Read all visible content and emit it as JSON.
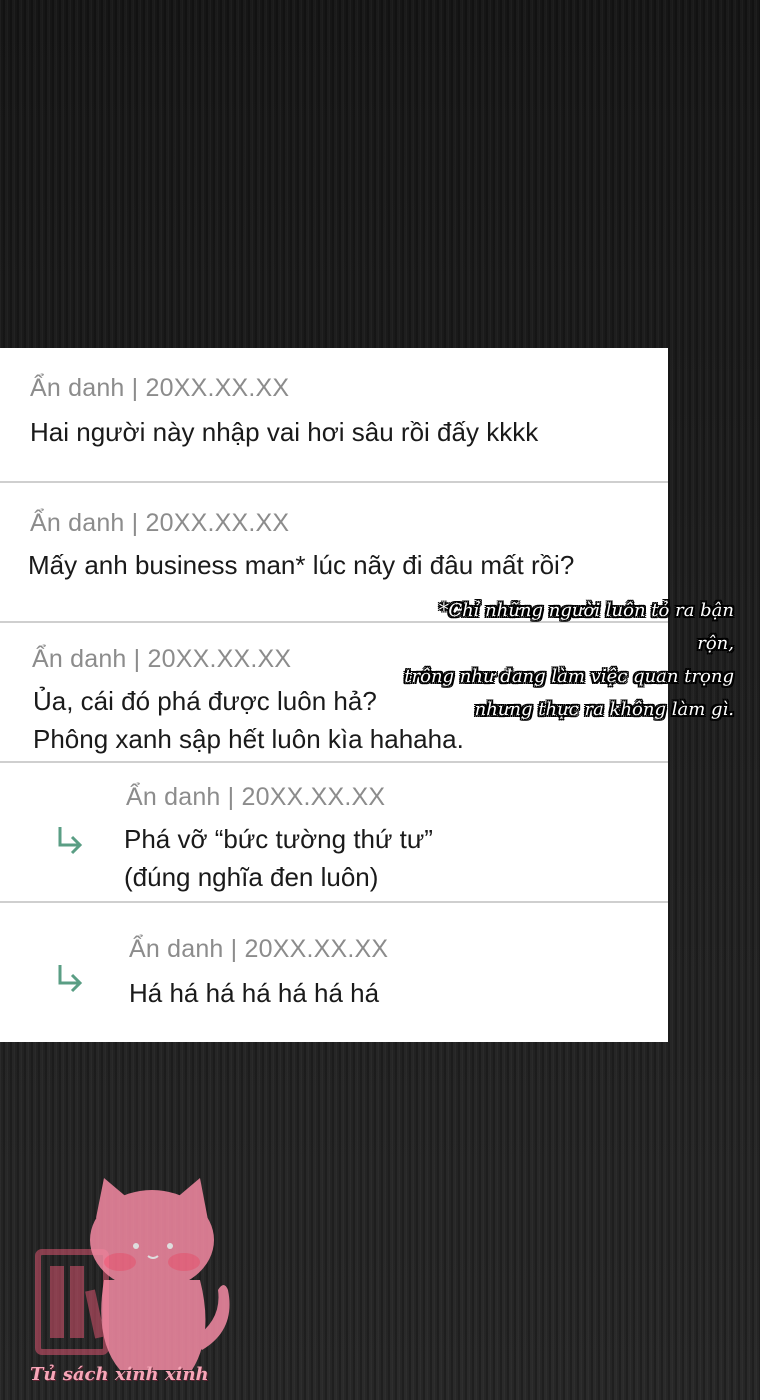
{
  "comments": [
    {
      "meta": "Ẩn danh | 20XX.XX.XX",
      "lines": [
        "Hai người này nhập vai hơi sâu rồi đấy kkkk"
      ],
      "is_reply": false
    },
    {
      "meta": "Ẩn danh | 20XX.XX.XX",
      "lines": [
        "Mấy anh business man* lúc nãy đi đâu mất rồi?"
      ],
      "is_reply": false
    },
    {
      "meta": "Ẩn danh | 20XX.XX.XX",
      "lines": [
        "Ủa, cái đó phá được luôn hả?",
        "Phông xanh sập hết luôn kìa hahaha."
      ],
      "is_reply": false
    },
    {
      "meta": "Ẩn danh | 20XX.XX.XX",
      "lines": [
        "Phá vỡ “bức tường thứ tư”",
        "(đúng nghĩa đen luôn)"
      ],
      "is_reply": true
    },
    {
      "meta": "Ẩn danh | 20XX.XX.XX",
      "lines": [
        "Há há há há há há há"
      ],
      "is_reply": true
    }
  ],
  "footnote": {
    "lines": [
      "*Chỉ những người luôn tỏ ra bận rộn,",
      "trông như đang làm việc quan trọng",
      "nhưng thực ra không làm gì."
    ]
  },
  "watermark": {
    "text": "Tủ sách xinh xinh"
  },
  "icons": {
    "reply": "reply-arrow-icon",
    "watermark_cat": "cat-mascot-icon",
    "watermark_books": "bookshelf-icon"
  },
  "colors": {
    "reply_arrow": "#5a9e84",
    "meta_text": "#8c8c8c",
    "body_text": "#1a1a1a",
    "watermark_pink": "#f7a6b8"
  }
}
